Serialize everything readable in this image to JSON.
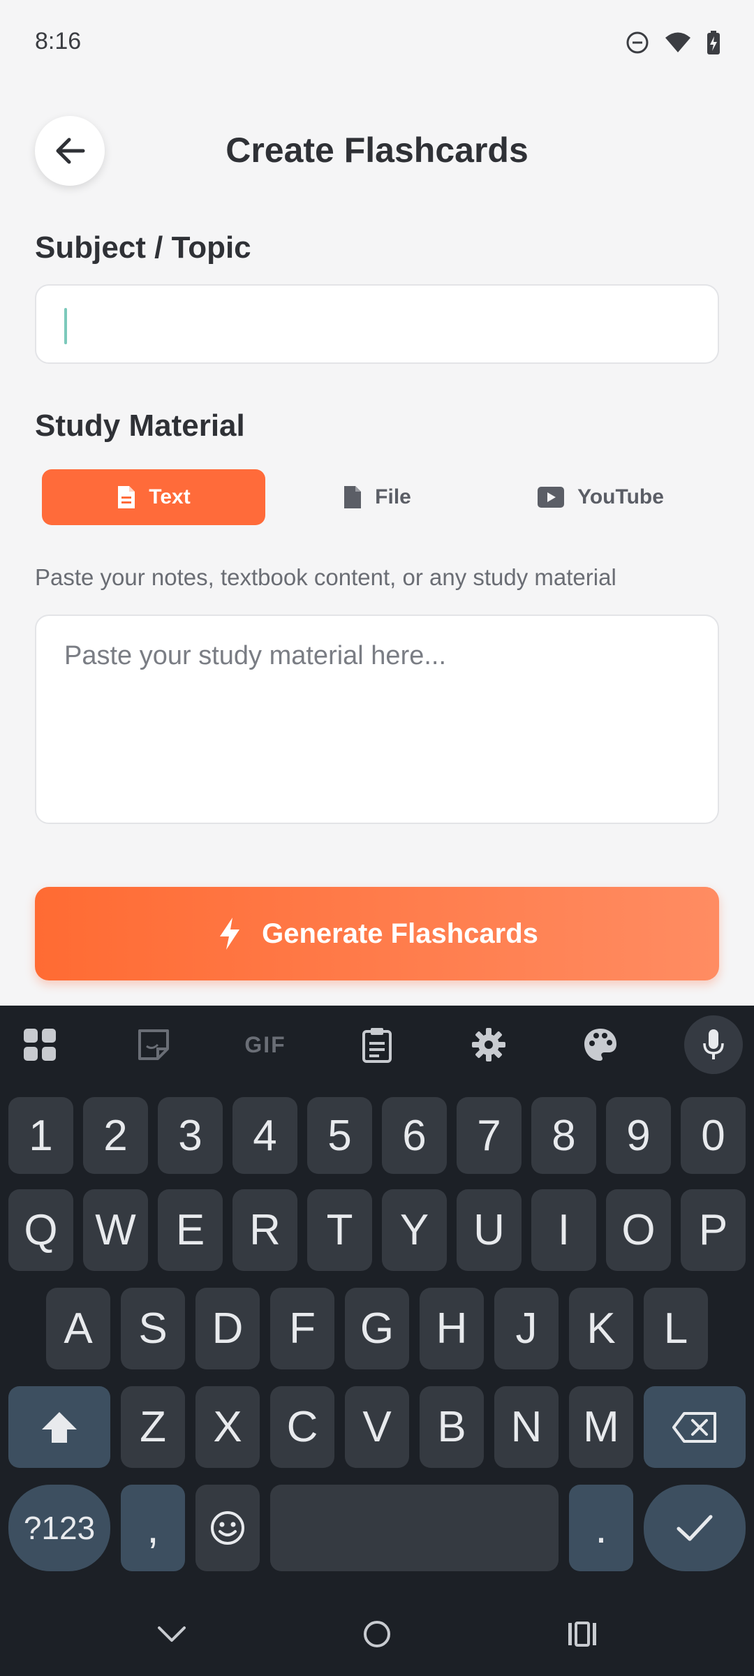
{
  "status_bar": {
    "time": "8:16"
  },
  "header": {
    "title": "Create Flashcards"
  },
  "subject": {
    "label": "Subject / Topic",
    "value": ""
  },
  "material": {
    "label": "Study Material",
    "tabs": [
      {
        "label": "Text",
        "icon": "document-icon",
        "active": true
      },
      {
        "label": "File",
        "icon": "file-icon",
        "active": false
      },
      {
        "label": "YouTube",
        "icon": "youtube-icon",
        "active": false
      }
    ],
    "hint": "Paste your notes, textbook content, or any study material",
    "placeholder": "Paste your study material here..."
  },
  "generate": {
    "label": "Generate Flashcards",
    "icon": "lightning-icon"
  },
  "colors": {
    "accent": "#ff6b3a",
    "accent_end": "#ff8c62",
    "keyboard_bg": "#1c2026",
    "key_bg": "#353a41",
    "func_key_bg": "#3d4f60",
    "caret": "#7cc9bb"
  },
  "keyboard": {
    "toolbar": [
      "apps-icon",
      "sticker-icon",
      "gif-icon",
      "clipboard-icon",
      "settings-icon",
      "palette-icon",
      "mic-icon"
    ],
    "gif_label": "GIF",
    "row_numbers": [
      "1",
      "2",
      "3",
      "4",
      "5",
      "6",
      "7",
      "8",
      "9",
      "0"
    ],
    "row_1": [
      "Q",
      "W",
      "E",
      "R",
      "T",
      "Y",
      "U",
      "I",
      "O",
      "P"
    ],
    "row_2": [
      "A",
      "S",
      "D",
      "F",
      "G",
      "H",
      "J",
      "K",
      "L"
    ],
    "row_3": [
      "Z",
      "X",
      "C",
      "V",
      "B",
      "N",
      "M"
    ],
    "symbols_label": "?123",
    "comma": ",",
    "period": "."
  }
}
